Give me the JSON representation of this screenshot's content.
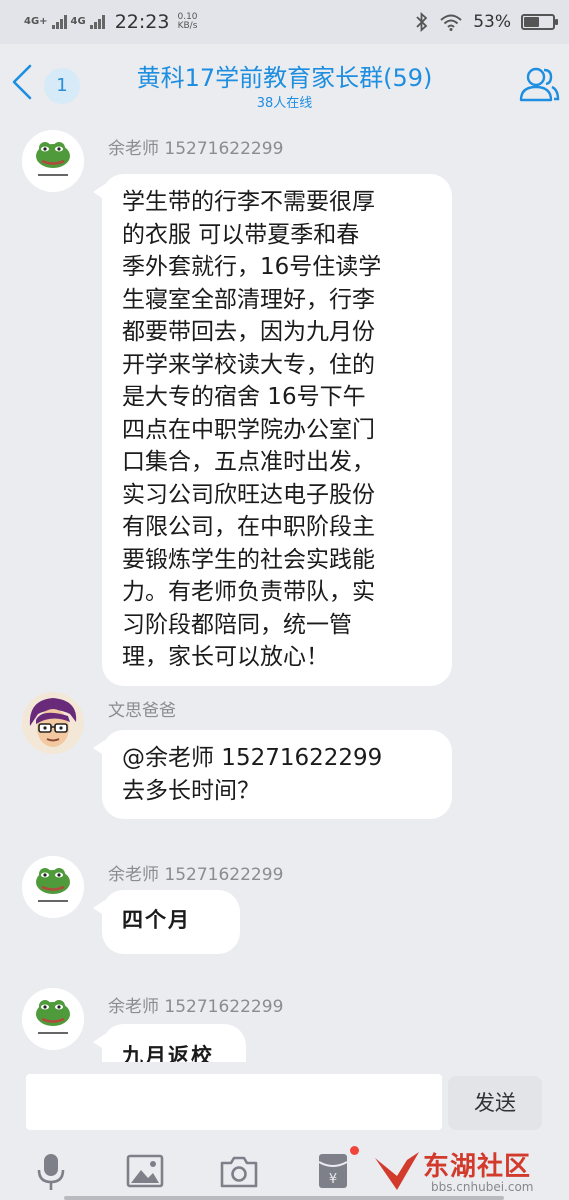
{
  "status_bar": {
    "signal1": "4G+",
    "signal2": "4G",
    "time": "22:23",
    "net_speed_value": "0.10",
    "net_speed_unit": "KB/s",
    "battery": "53%",
    "battery_level": 0.53
  },
  "header": {
    "unread_count": "1",
    "title": "黄科17学前教育家长群(59)",
    "subtitle": "38人在线"
  },
  "messages": [
    {
      "sender": "余老师 15271622299",
      "avatar": "frog-sticker-avatar",
      "lines": [
        "学生带的行李不需要很厚",
        "的衣服 可以带夏季和春",
        "季外套就行，16号住读学",
        "生寝室全部清理好，行李",
        "都要带回去，因为九月份",
        "开学来学校读大专，住的",
        "是大专的宿舍  16号下午",
        "四点在中职学院办公室门",
        "口集合，五点准时出发，",
        "实习公司欣旺达电子股份",
        "有限公司，在中职阶段主",
        "要锻炼学生的社会实践能",
        "力。有老师负责带队，实",
        "习阶段都陪同，统一管",
        "理，家长可以放心！"
      ]
    },
    {
      "sender": "文思爸爸",
      "avatar": "cartoon-man-avatar",
      "lines": [
        "@余老师 15271622299",
        "去多长时间？"
      ]
    },
    {
      "sender": "余老师 15271622299",
      "avatar": "frog-sticker-avatar",
      "lines": [
        "四个月"
      ]
    },
    {
      "sender": "余老师 15271622299",
      "avatar": "frog-sticker-avatar",
      "lines": [
        "九月返校"
      ]
    }
  ],
  "input": {
    "value": "",
    "send_label": "发送"
  },
  "toolbar": [
    "microphone-icon",
    "image-icon",
    "camera-icon",
    "red-packet-icon"
  ],
  "watermark": {
    "text": "东湖社区",
    "url": "bbs.cnhubei.com"
  }
}
